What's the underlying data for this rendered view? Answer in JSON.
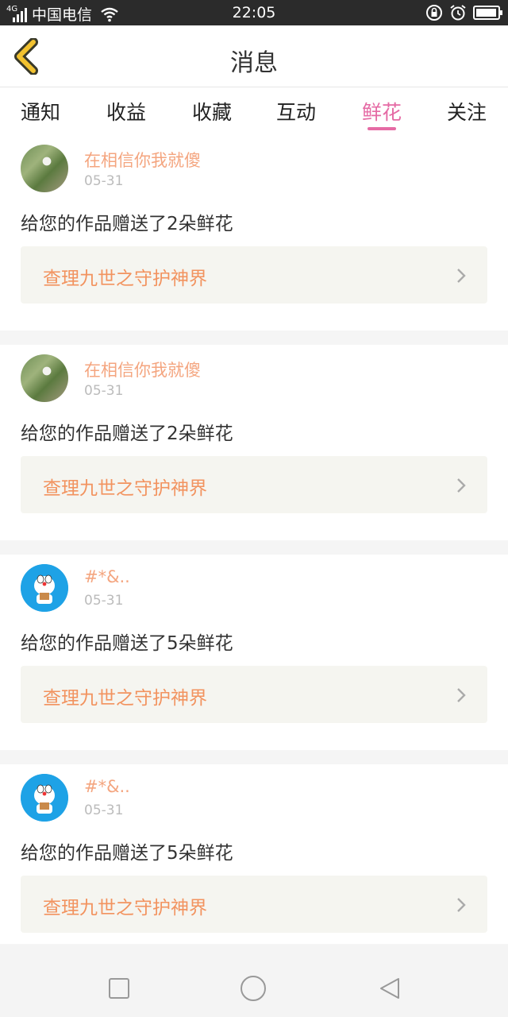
{
  "status_bar": {
    "network": "4G",
    "carrier": "中国电信",
    "time": "22:05",
    "battery_level": 0.95
  },
  "header": {
    "back_icon": "chevron-left-icon",
    "title": "消息"
  },
  "tabs": [
    {
      "label": "通知",
      "active": false
    },
    {
      "label": "收益",
      "active": false
    },
    {
      "label": "收藏",
      "active": false
    },
    {
      "label": "互动",
      "active": false
    },
    {
      "label": "鲜花",
      "active": true
    },
    {
      "label": "关注",
      "active": false
    }
  ],
  "messages": [
    {
      "user": "在相信你我就傻",
      "date": "05-31",
      "text": "给您的作品赠送了2朵鲜花",
      "work": "查理九世之守护神界",
      "avatar": "photo"
    },
    {
      "user": "在相信你我就傻",
      "date": "05-31",
      "text": "给您的作品赠送了2朵鲜花",
      "work": "查理九世之守护神界",
      "avatar": "photo"
    },
    {
      "user": "#*&..",
      "date": "05-31",
      "text": "给您的作品赠送了5朵鲜花",
      "work": "查理九世之守护神界",
      "avatar": "doraemon"
    },
    {
      "user": "#*&..",
      "date": "05-31",
      "text": "给您的作品赠送了5朵鲜花",
      "work": "查理九世之守护神界",
      "avatar": "doraemon"
    }
  ],
  "colors": {
    "accent_pink": "#e56aa4",
    "username_orange": "#f4a57f",
    "link_orange": "#f2935f",
    "back_yellow": "#f2c230"
  },
  "nav": [
    "recents-icon",
    "home-icon",
    "back-icon"
  ]
}
